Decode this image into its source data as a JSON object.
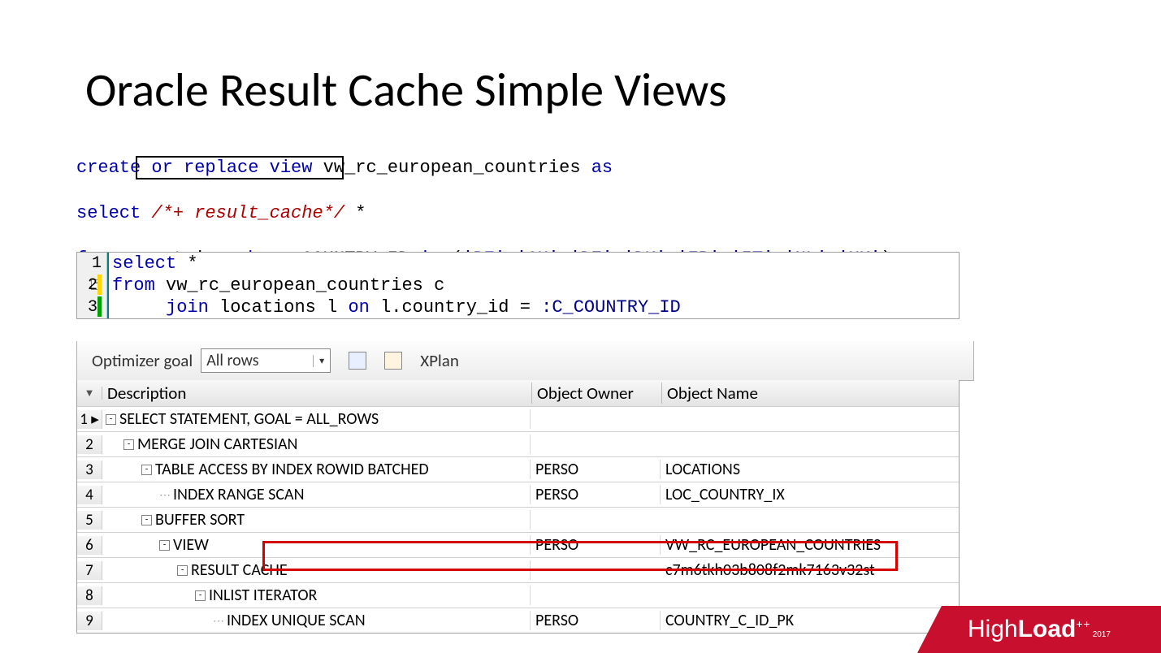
{
  "title": "Oracle Result Cache Simple Views",
  "sql1": {
    "l1a": "create",
    "l1b": "or",
    "l1c": "replace",
    "l1d": "view",
    "l1e": "vw_rc_european_countries",
    "l1f": "as",
    "l2a": "select",
    "l2b": "/*+ result_cache*/",
    "l2c": "*",
    "l3a": "from",
    "l3b": "countries",
    "l3c": "where",
    "l3d": "COUNTRY_ID",
    "l3e": "in",
    "l3f": "(",
    "l3g": "'BE','CH','DE','DK','FR','IT','NL','UK'",
    "l3h": ")",
    "l4": "/"
  },
  "editor": {
    "g1": "1",
    "g2": "2",
    "g3": "3",
    "l1a": "select",
    "l1b": "*",
    "l2a": "from",
    "l2b": "vw_rc_european_countries c",
    "l3a": "join",
    "l3b": "locations l",
    "l3c": "on",
    "l3d": "l.country_id",
    "l3e": ":C_COUNTRY_ID"
  },
  "toolbar": {
    "label": "Optimizer goal",
    "combo": "All rows",
    "xplan": "XPlan"
  },
  "plan": {
    "head": {
      "desc": "Description",
      "owner": "Object Owner",
      "name": "Object Name"
    },
    "rows": [
      {
        "n": "1",
        "indent": 0,
        "box": "-",
        "marker": "▸",
        "desc": "SELECT STATEMENT, GOAL = ALL_ROWS",
        "owner": "",
        "name": ""
      },
      {
        "n": "2",
        "indent": 1,
        "box": "-",
        "desc": "MERGE JOIN CARTESIAN",
        "owner": "",
        "name": ""
      },
      {
        "n": "3",
        "indent": 2,
        "box": "-",
        "desc": "TABLE ACCESS BY INDEX ROWID BATCHED",
        "owner": "PERSO",
        "name": "LOCATIONS"
      },
      {
        "n": "4",
        "indent": 3,
        "box": "",
        "dots": true,
        "desc": "INDEX RANGE SCAN",
        "owner": "PERSO",
        "name": "LOC_COUNTRY_IX"
      },
      {
        "n": "5",
        "indent": 2,
        "box": "-",
        "desc": "BUFFER SORT",
        "owner": "",
        "name": ""
      },
      {
        "n": "6",
        "indent": 3,
        "box": "-",
        "desc": "VIEW",
        "owner": "PERSO",
        "name": "VW_RC_EUROPEAN_COUNTRIES"
      },
      {
        "n": "7",
        "indent": 4,
        "box": "-",
        "desc": "RESULT CACHE",
        "owner": "",
        "name": "c7m6tkh03b808f2mk7163v32st"
      },
      {
        "n": "8",
        "indent": 5,
        "box": "-",
        "desc": "INLIST ITERATOR",
        "owner": "",
        "name": ""
      },
      {
        "n": "9",
        "indent": 6,
        "box": "",
        "dots": true,
        "desc": "INDEX UNIQUE SCAN",
        "owner": "PERSO",
        "name": "COUNTRY_C_ID_PK"
      }
    ]
  },
  "logo": {
    "a": "High",
    "b": "Load",
    "c": "++",
    "d": "2017"
  }
}
